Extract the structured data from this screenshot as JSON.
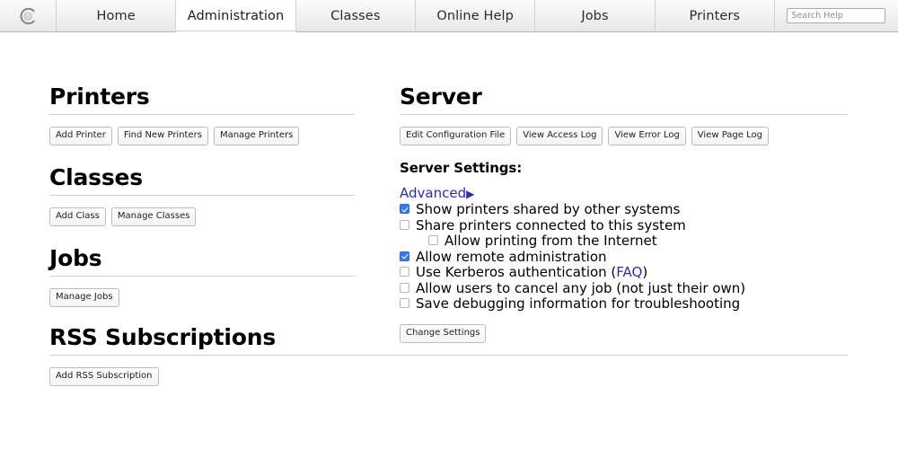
{
  "nav": {
    "logo_icon": "cups-c-logo-icon",
    "tabs": [
      {
        "label": "Home",
        "active": false
      },
      {
        "label": "Administration",
        "active": true
      },
      {
        "label": "Classes",
        "active": false
      },
      {
        "label": "Online Help",
        "active": false
      },
      {
        "label": "Jobs",
        "active": false
      },
      {
        "label": "Printers",
        "active": false
      }
    ],
    "search": {
      "placeholder": "Search Help",
      "value": ""
    }
  },
  "printers": {
    "heading": "Printers",
    "buttons": [
      "Add Printer",
      "Find New Printers",
      "Manage Printers"
    ]
  },
  "classes": {
    "heading": "Classes",
    "buttons": [
      "Add Class",
      "Manage Classes"
    ]
  },
  "jobs": {
    "heading": "Jobs",
    "buttons": [
      "Manage Jobs"
    ]
  },
  "rss": {
    "heading": "RSS Subscriptions",
    "buttons": [
      "Add RSS Subscription"
    ]
  },
  "server": {
    "heading": "Server",
    "buttons": [
      "Edit Configuration File",
      "View Access Log",
      "View Error Log",
      "View Page Log"
    ],
    "settings_heading": "Server Settings:",
    "advanced_label": "Advanced",
    "advanced_triangle": "▶",
    "options": [
      {
        "label": "Show printers shared by other systems",
        "checked": true,
        "indent": false
      },
      {
        "label": "Share printers connected to this system",
        "checked": false,
        "indent": false
      },
      {
        "label": "Allow printing from the Internet",
        "checked": false,
        "indent": true
      },
      {
        "label": "Allow remote administration",
        "checked": true,
        "indent": false
      },
      {
        "label": "Use Kerberos authentication (",
        "checked": false,
        "indent": false,
        "link_text": "FAQ",
        "label_after": ")"
      },
      {
        "label": "Allow users to cancel any job (not just their own)",
        "checked": false,
        "indent": false
      },
      {
        "label": "Save debugging information for troubleshooting",
        "checked": false,
        "indent": false
      }
    ],
    "change_settings_label": "Change Settings"
  },
  "colors": {
    "link": "#2b2bbb",
    "checkbox_checked": "#3478f6",
    "rule": "#cfcfcf",
    "tabbar_border": "#b3b3b3"
  }
}
